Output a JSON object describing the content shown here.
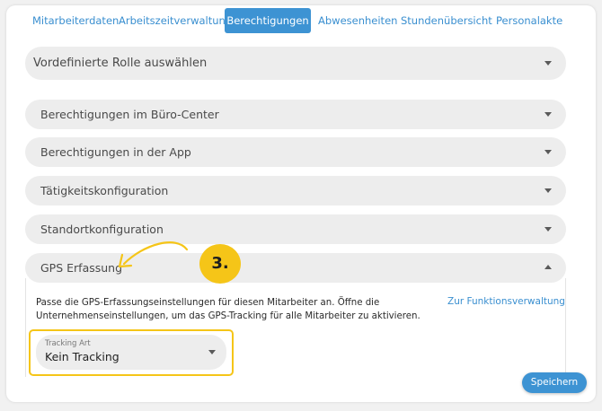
{
  "tabs": [
    {
      "label": "Mitarbeiterdaten",
      "active": false
    },
    {
      "label": "Arbeitszeitverwaltung",
      "active": false
    },
    {
      "label": "Berechtigungen",
      "active": true
    },
    {
      "label": "Abwesenheiten",
      "active": false
    },
    {
      "label": "Stundenübersicht",
      "active": false
    },
    {
      "label": "Personalakte",
      "active": false
    }
  ],
  "role_select": {
    "label": "Vordefinierte Rolle auswählen",
    "icon": "chevron-down-icon"
  },
  "sections": [
    {
      "label": "Berechtigungen im Büro-Center",
      "expanded": false
    },
    {
      "label": "Berechtigungen in der App",
      "expanded": false
    },
    {
      "label": "Tätigkeitskonfiguration",
      "expanded": false
    },
    {
      "label": "Standortkonfiguration",
      "expanded": false
    },
    {
      "label": "GPS Erfassung",
      "expanded": true
    }
  ],
  "gps_panel": {
    "description": "Passe die GPS-Erfassungseinstellungen für diesen Mitarbeiter an. Öffne die Unternehmenseinstellungen, um das GPS-Tracking für alle Mitarbeiter zu aktivieren.",
    "link_label": "Zur Funktionsverwaltung",
    "tracking_select": {
      "label": "Tracking Art",
      "value": "Kein Tracking"
    }
  },
  "save_label": "Speichern",
  "annotation": {
    "step_label": "3.",
    "color": "#f5c518"
  },
  "colors": {
    "accent": "#3d93d3",
    "link": "#3a8fd0",
    "pill_bg": "#ededed"
  }
}
